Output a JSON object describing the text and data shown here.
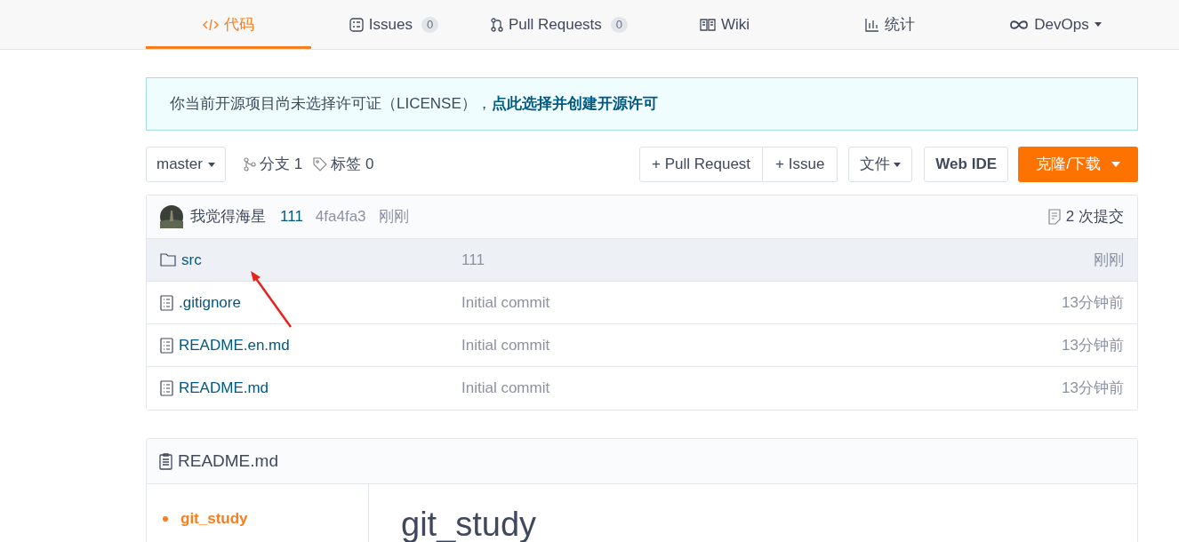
{
  "tabs": [
    {
      "label": "代码",
      "selected": true
    },
    {
      "label": "Issues",
      "count": "0",
      "selected": false
    },
    {
      "label": "Pull Requests",
      "count": "0",
      "selected": false
    },
    {
      "label": "Wiki",
      "selected": false
    },
    {
      "label": "统计",
      "selected": false
    },
    {
      "label": "DevOps",
      "dropdown": true,
      "selected": false
    }
  ],
  "notice": {
    "text": "你当前开源项目尚未选择许可证（LICENSE），",
    "link": "点此选择并创建开源许可"
  },
  "toolbar": {
    "branch": "master",
    "branches": "分支 1",
    "tags": "标签 0",
    "pull_request": "+ Pull Request",
    "issue": "+ Issue",
    "file_menu": "文件",
    "web_ide": "Web IDE",
    "clone": "克隆/下载"
  },
  "commit": {
    "author": "我觉得海星",
    "message": "111",
    "hash": "4fa4fa3",
    "time": "刚刚",
    "count": "2 次提交"
  },
  "files": [
    {
      "kind": "folder",
      "name": "src",
      "message": "111",
      "time": "刚刚",
      "selected": true
    },
    {
      "kind": "file",
      "name": ".gitignore",
      "message": "Initial commit",
      "time": "13分钟前",
      "selected": false
    },
    {
      "kind": "file",
      "name": "README.en.md",
      "message": "Initial commit",
      "time": "13分钟前",
      "selected": false
    },
    {
      "kind": "file",
      "name": "README.md",
      "message": "Initial commit",
      "time": "13分钟前",
      "selected": false
    }
  ],
  "readme": {
    "title": "README.md",
    "toc": [
      "git_study"
    ],
    "heading": "git_study"
  }
}
